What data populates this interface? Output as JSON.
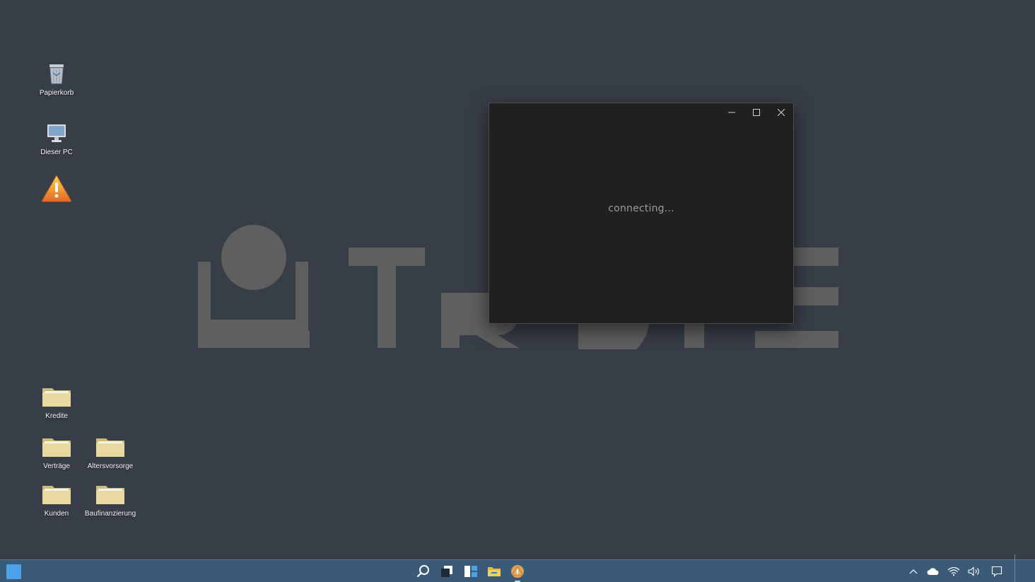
{
  "desktop": {
    "icons": [
      {
        "label": "Papierkorb",
        "icon": "recycle-bin-icon"
      },
      {
        "label": "Dieser PC",
        "icon": "computer-icon"
      },
      {
        "label": "",
        "icon": "warning-icon"
      },
      {
        "label": "Kredite",
        "icon": "folder-icon"
      },
      {
        "label": "Verträge",
        "icon": "folder-icon"
      },
      {
        "label": "Altersvorsorge",
        "icon": "folder-icon"
      },
      {
        "label": "Kunden",
        "icon": "folder-icon"
      },
      {
        "label": "Baufinanzierung",
        "icon": "folder-icon"
      }
    ]
  },
  "window": {
    "status": "connecting..."
  },
  "taskbar": {
    "pinned": [
      "search-icon",
      "task-view-icon",
      "widgets-icon",
      "file-explorer-icon",
      "app-warning-icon"
    ],
    "tray": [
      "chevron-up-icon",
      "cloud-icon",
      "wifi-icon",
      "volume-icon",
      "notification-icon"
    ]
  },
  "colors": {
    "desktop_bg": "#383e48",
    "taskbar_bg": "#3a5a78",
    "window_bg": "#202020",
    "accent": "#4aa3e8",
    "folder": "#e8d9a0"
  }
}
